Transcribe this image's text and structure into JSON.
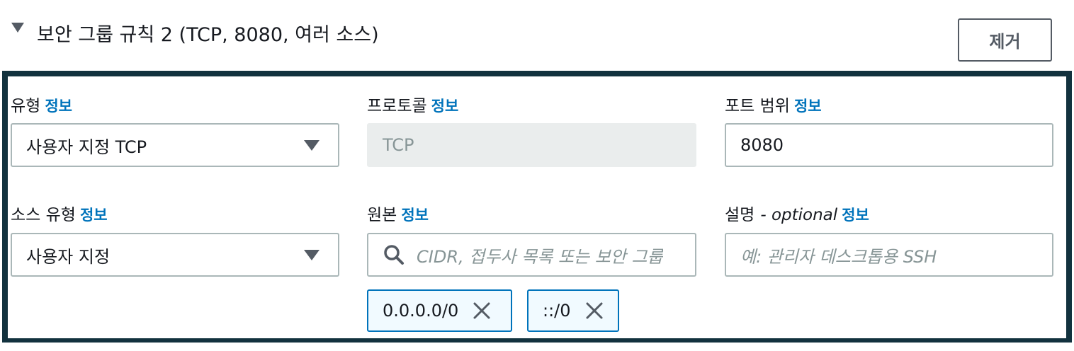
{
  "rule": {
    "title": "보안 그룹 규칙 2 (TCP, 8080, 여러 소스)",
    "remove_label": "제거"
  },
  "fields": {
    "type": {
      "label": "유형",
      "info": "정보",
      "value": "사용자 지정 TCP"
    },
    "protocol": {
      "label": "프로토콜",
      "info": "정보",
      "value": "TCP"
    },
    "port_range": {
      "label": "포트 범위",
      "info": "정보",
      "value": "8080"
    },
    "source_type": {
      "label": "소스 유형",
      "info": "정보",
      "value": "사용자 지정"
    },
    "source": {
      "label": "원본",
      "info": "정보",
      "placeholder": "CIDR, 접두사 목록 또는 보안 그룹"
    },
    "description": {
      "label": "설명",
      "optional": "- optional",
      "info": "정보",
      "placeholder": "예: 관리자 데스크톱용 SSH"
    }
  },
  "source_tokens": [
    {
      "value": "0.0.0.0/0"
    },
    {
      "value": "::/0"
    }
  ],
  "icons": {
    "expand": "caret-down-icon",
    "dropdown": "chevron-down-icon",
    "search": "search-icon",
    "remove_token": "close-icon"
  },
  "colors": {
    "panel_border": "#12323e",
    "link": "#0073bb",
    "token_border": "#0073bb",
    "disabled_bg": "#eaeded"
  }
}
